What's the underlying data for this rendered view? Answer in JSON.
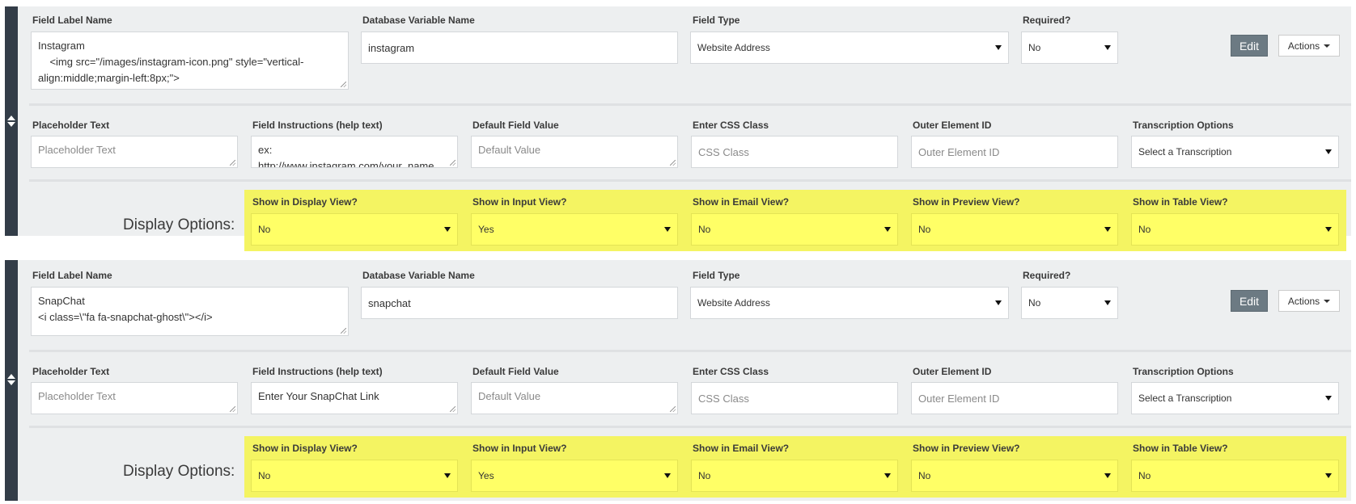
{
  "labels": {
    "field_label_name": "Field Label Name",
    "database_variable_name": "Database Variable Name",
    "field_type": "Field Type",
    "required": "Required?",
    "placeholder_text": "Placeholder Text",
    "field_instructions": "Field Instructions (help text)",
    "default_field_value": "Default Field Value",
    "enter_css_class": "Enter CSS Class",
    "outer_element_id": "Outer Element ID",
    "transcription_options": "Transcription Options",
    "display_options": "Display Options:",
    "show_display_view": "Show in Display View?",
    "show_input_view": "Show in Input View?",
    "show_email_view": "Show in Email View?",
    "show_preview_view": "Show in Preview View?",
    "show_table_view": "Show in Table View?",
    "edit": "Edit",
    "actions": "Actions"
  },
  "placeholders": {
    "placeholder_text": "Placeholder Text",
    "default_field_value": "Default Value",
    "css_class": "CSS Class",
    "outer_element_id": "Outer Element ID",
    "transcription": "Select a Transcription"
  },
  "fields": [
    {
      "label_name": "Instagram\n    <img src=\"/images/instagram-icon.png\" style=\"vertical-align:middle;margin-left:8px;\">",
      "variable_name": "instagram",
      "field_type": "Website Address",
      "required": "No",
      "instructions": "ex:\nhttp://www.instagram.com/your_name",
      "display_view": "No",
      "input_view": "Yes",
      "email_view": "No",
      "preview_view": "No",
      "table_view": "No"
    },
    {
      "label_name": "SnapChat\n<i class=\\\"fa fa-snapchat-ghost\\\"></i>",
      "variable_name": "snapchat",
      "field_type": "Website Address",
      "required": "No",
      "instructions": "Enter Your SnapChat Link",
      "display_view": "No",
      "input_view": "Yes",
      "email_view": "No",
      "preview_view": "No",
      "table_view": "No"
    }
  ],
  "colors": {
    "handle": "#333d48",
    "card_bg": "#edeff0",
    "highlight": "#f4f462",
    "edit_button": "#6c7a83"
  }
}
